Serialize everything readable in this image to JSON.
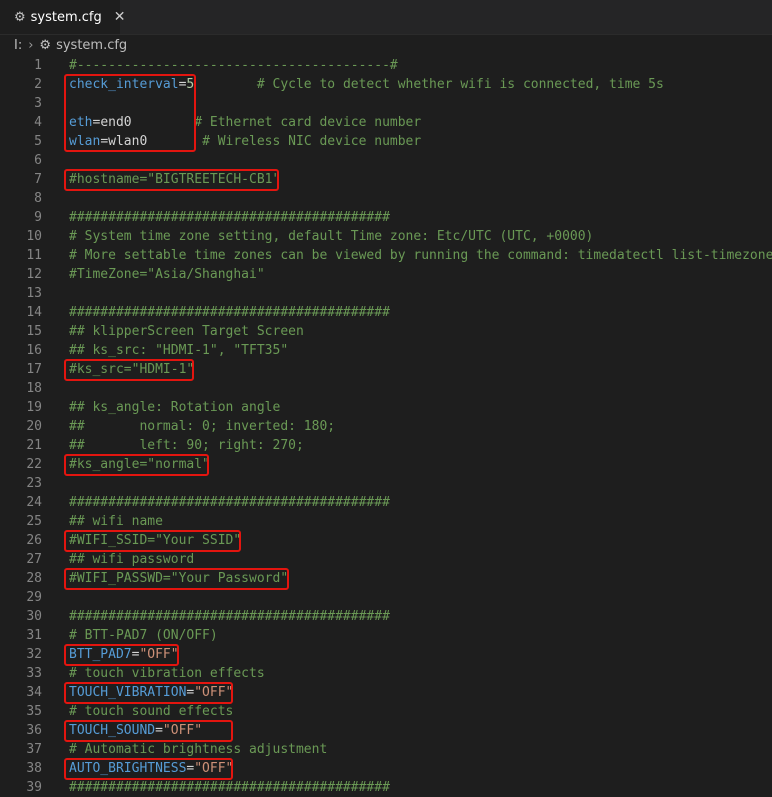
{
  "tab": {
    "icon": "gear-icon",
    "title": "system.cfg",
    "close": "✕"
  },
  "breadcrumb": {
    "root": "I:",
    "separator": "›",
    "icon": "gear-icon",
    "file": "system.cfg"
  },
  "lines": [
    {
      "n": "1",
      "t": [
        [
          "cm",
          "#----------------------------------------#"
        ]
      ]
    },
    {
      "n": "2",
      "t": [
        [
          "key",
          "check_interval"
        ],
        [
          "op",
          "="
        ],
        [
          "num",
          "5"
        ],
        [
          "cm",
          "        # Cycle to detect whether wifi is connected, time 5s"
        ]
      ]
    },
    {
      "n": "3",
      "t": []
    },
    {
      "n": "4",
      "t": [
        [
          "key",
          "eth"
        ],
        [
          "op",
          "="
        ],
        [
          "plain",
          "end0"
        ],
        [
          "cm",
          "        # Ethernet card device number"
        ]
      ]
    },
    {
      "n": "5",
      "t": [
        [
          "key",
          "wlan"
        ],
        [
          "op",
          "="
        ],
        [
          "plain",
          "wlan0"
        ],
        [
          "cm",
          "       # Wireless NIC device number"
        ]
      ]
    },
    {
      "n": "6",
      "t": []
    },
    {
      "n": "7",
      "t": [
        [
          "cm",
          "#hostname=\"BIGTREETECH-CB1\""
        ]
      ]
    },
    {
      "n": "8",
      "t": []
    },
    {
      "n": "9",
      "t": [
        [
          "cm",
          "#########################################"
        ]
      ]
    },
    {
      "n": "10",
      "t": [
        [
          "cm",
          "# System time zone setting, default Time zone: Etc/UTC (UTC, +0000)"
        ]
      ]
    },
    {
      "n": "11",
      "t": [
        [
          "cm",
          "# More settable time zones can be viewed by running the command: timedatectl list-timezones"
        ]
      ]
    },
    {
      "n": "12",
      "t": [
        [
          "cm",
          "#TimeZone=\"Asia/Shanghai\""
        ]
      ]
    },
    {
      "n": "13",
      "t": []
    },
    {
      "n": "14",
      "t": [
        [
          "cm",
          "#########################################"
        ]
      ]
    },
    {
      "n": "15",
      "t": [
        [
          "cm",
          "## klipperScreen Target Screen"
        ]
      ]
    },
    {
      "n": "16",
      "t": [
        [
          "cm",
          "## ks_src: \"HDMI-1\", \"TFT35\""
        ]
      ]
    },
    {
      "n": "17",
      "t": [
        [
          "cm",
          "#ks_src=\"HDMI-1\""
        ]
      ]
    },
    {
      "n": "18",
      "t": []
    },
    {
      "n": "19",
      "t": [
        [
          "cm",
          "## ks_angle: Rotation angle"
        ]
      ]
    },
    {
      "n": "20",
      "t": [
        [
          "cm",
          "##       normal: 0; inverted: 180;"
        ]
      ]
    },
    {
      "n": "21",
      "t": [
        [
          "cm",
          "##       left: 90; right: 270;"
        ]
      ]
    },
    {
      "n": "22",
      "t": [
        [
          "cm",
          "#ks_angle=\"normal\""
        ]
      ]
    },
    {
      "n": "23",
      "t": []
    },
    {
      "n": "24",
      "t": [
        [
          "cm",
          "#########################################"
        ]
      ]
    },
    {
      "n": "25",
      "t": [
        [
          "cm",
          "## wifi name"
        ]
      ]
    },
    {
      "n": "26",
      "t": [
        [
          "cm",
          "#WIFI_SSID=\"Your SSID\""
        ]
      ]
    },
    {
      "n": "27",
      "t": [
        [
          "cm",
          "## wifi password"
        ]
      ]
    },
    {
      "n": "28",
      "t": [
        [
          "cm",
          "#WIFI_PASSWD=\"Your Password\""
        ]
      ]
    },
    {
      "n": "29",
      "t": []
    },
    {
      "n": "30",
      "t": [
        [
          "cm",
          "#########################################"
        ]
      ]
    },
    {
      "n": "31",
      "t": [
        [
          "cm",
          "# BTT-PAD7 (ON/OFF)"
        ]
      ]
    },
    {
      "n": "32",
      "t": [
        [
          "key",
          "BTT_PAD7"
        ],
        [
          "op",
          "="
        ],
        [
          "str",
          "\"OFF\""
        ]
      ]
    },
    {
      "n": "33",
      "t": [
        [
          "cm",
          "# touch vibration effects"
        ]
      ]
    },
    {
      "n": "34",
      "t": [
        [
          "key",
          "TOUCH_VIBRATION"
        ],
        [
          "op",
          "="
        ],
        [
          "str",
          "\"OFF\""
        ]
      ]
    },
    {
      "n": "35",
      "t": [
        [
          "cm",
          "# touch sound effects"
        ]
      ]
    },
    {
      "n": "36",
      "t": [
        [
          "key",
          "TOUCH_SOUND"
        ],
        [
          "op",
          "="
        ],
        [
          "str",
          "\"OFF\""
        ]
      ]
    },
    {
      "n": "37",
      "t": [
        [
          "cm",
          "# Automatic brightness adjustment"
        ]
      ]
    },
    {
      "n": "38",
      "t": [
        [
          "key",
          "AUTO_BRIGHTNESS"
        ],
        [
          "op",
          "="
        ],
        [
          "str",
          "\"OFF\""
        ]
      ]
    },
    {
      "n": "39",
      "t": [
        [
          "cm",
          "#########################################"
        ]
      ]
    }
  ],
  "colors": {
    "highlight_box": "#e3150f",
    "comment": "#6a9955",
    "keyword": "#569cd6",
    "string": "#ce9178",
    "number": "#b5cea8"
  }
}
